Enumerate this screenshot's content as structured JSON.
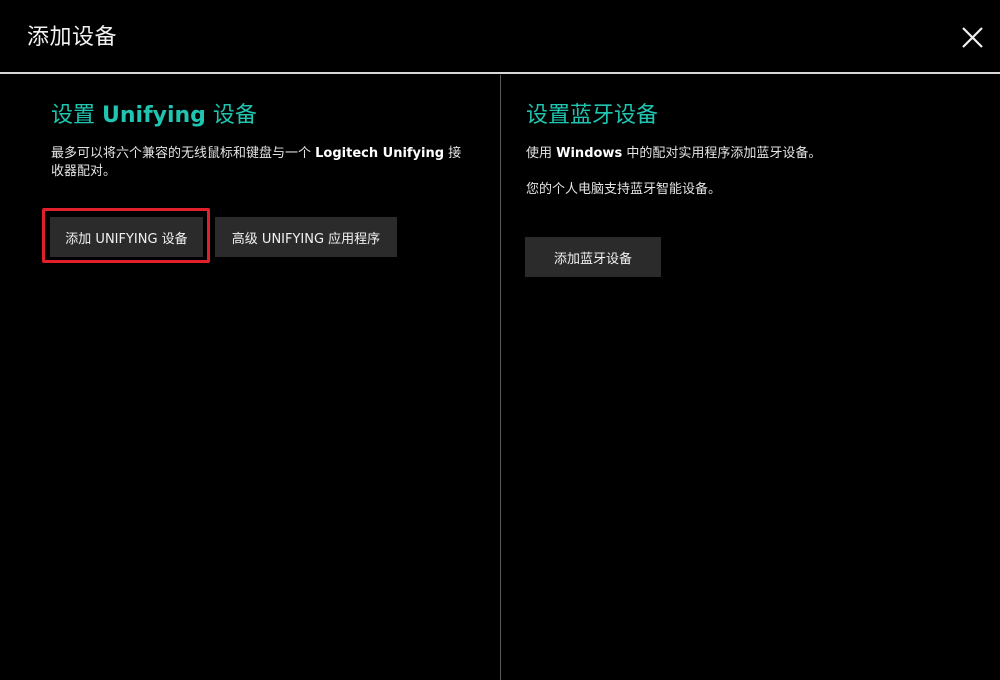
{
  "window": {
    "title": "添加设备",
    "close_icon": "close-icon"
  },
  "unifying": {
    "title_prefix": "设置 ",
    "title_brand": "Unifying",
    "title_suffix": " 设备",
    "desc_line1_prefix": "最多可以将六个兼容的无线鼠标和键盘与一个 ",
    "desc_line1_brand": "Logitech Unifying",
    "desc_line1_suffix": " 接",
    "desc_line2": "收器配对。",
    "add_button": "添加 UNIFYING 设备",
    "advanced_button": "高级 UNIFYING 应用程序"
  },
  "bluetooth": {
    "title": "设置蓝牙设备",
    "desc1_prefix": "使用 ",
    "desc1_brand": "Windows",
    "desc1_suffix": " 中的配对实用程序添加蓝牙设备。",
    "desc2": "您的个人电脑支持蓝牙智能设备。",
    "add_button": "添加蓝牙设备"
  },
  "colors": {
    "accent": "#1fc5b0",
    "highlight": "#e0212b",
    "button_bg": "#2b2b2b",
    "background": "#000000"
  }
}
